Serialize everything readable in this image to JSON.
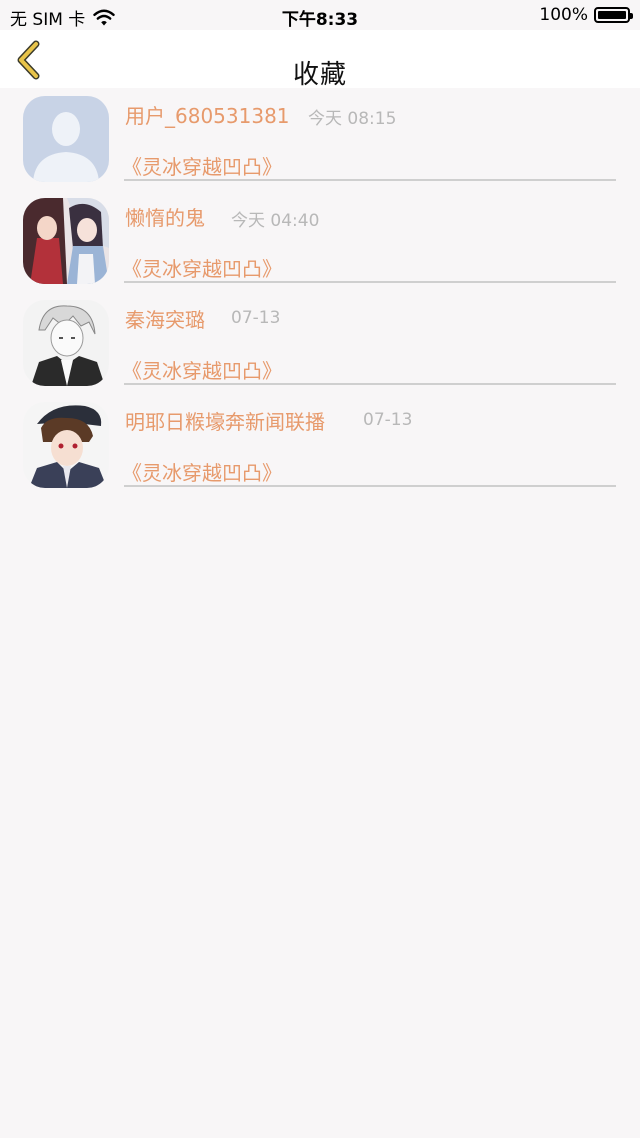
{
  "status_bar": {
    "carrier": "无 SIM 卡",
    "time": "下午8:33",
    "battery": "100%"
  },
  "nav": {
    "title": "收藏",
    "back_icon": "chevron-left-icon",
    "accent_color": "#e8c44a"
  },
  "items": [
    {
      "username": "用户_680531381",
      "time": "今天 08:15",
      "book": "《灵冰穿越凹凸》",
      "avatar": "default-avatar"
    },
    {
      "username": "懒惰的鬼",
      "time": "今天 04:40",
      "book": "《灵冰穿越凹凸》",
      "avatar": "anime-girls-avatar"
    },
    {
      "username": "秦海突璐",
      "time": "07-13",
      "book": "《灵冰穿越凹凸》",
      "avatar": "anime-boy-avatar"
    },
    {
      "username": "明耶日糇壕奔新闻联播",
      "time": "07-13",
      "book": "《灵冰穿越凹凸》",
      "avatar": "anime-boy-hat-avatar"
    }
  ],
  "colors": {
    "username": "#e79a6c",
    "timestamp": "#b8b8b8",
    "background": "#f8f6f7"
  }
}
